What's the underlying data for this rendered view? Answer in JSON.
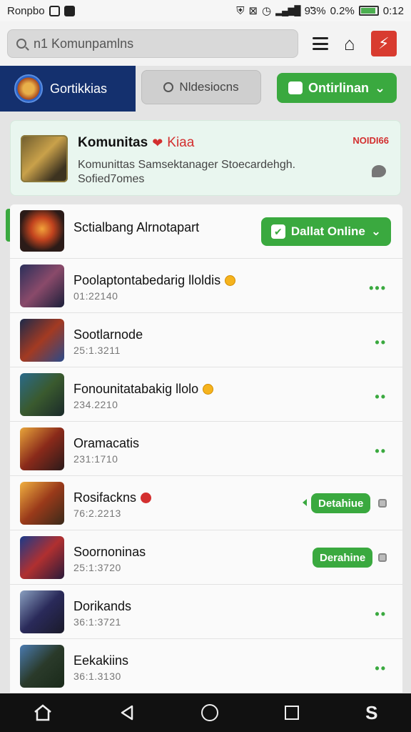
{
  "status_bar": {
    "app_name": "Ronpbo",
    "right_text": "9̃3%",
    "battery_text": "0.2%",
    "time": "0:12",
    "battery_level": 0.85
  },
  "topbar": {
    "search_text": "n1 Komunpamlns"
  },
  "tabs": {
    "profile_label": "Gortikkias",
    "search_label": "Nldesiocns",
    "online_label": "Ontirlinan"
  },
  "community": {
    "title": "Komunitas",
    "tag": "Kiaa",
    "badge": "NOIDI66",
    "description": "Komunittas Samsektanager Stoecardehgh. Sofied7omes"
  },
  "list_header": {
    "name": "Sctialbang Alrnotapart",
    "button_label": "Dallat Online"
  },
  "items": [
    {
      "name": "Poolaptontabedarig lloldis",
      "time": "01:22140",
      "badge": "coin",
      "action": "dots"
    },
    {
      "name": "Sootlarnode",
      "time": "25:1.3211",
      "badge": "",
      "action": "dots"
    },
    {
      "name": "Fonounitatabakig llolo",
      "time": "234.2210",
      "badge": "coin",
      "action": "dots"
    },
    {
      "name": "Oramacatis",
      "time": "231:1710",
      "badge": "",
      "action": "dots"
    },
    {
      "name": "Rosifackns",
      "time": "76:2.2213",
      "badge": "red",
      "action": "pill",
      "pill_label": "Detahiue"
    },
    {
      "name": "Soornoninas",
      "time": "25:1:3720",
      "badge": "",
      "action": "pill",
      "pill_label": "Derahine"
    },
    {
      "name": "Dorikands",
      "time": "36:1:3721",
      "badge": "",
      "action": "dots"
    },
    {
      "name": "Eekakiins",
      "time": "36:1.3130",
      "badge": "",
      "action": "dots"
    }
  ],
  "colors": {
    "accent_green": "#3aa93f",
    "profile_navy": "#14306e",
    "alert_red": "#d32f2f"
  },
  "icons": [
    "search-icon",
    "menu-icon",
    "home-icon",
    "bolt-icon",
    "chat-icon",
    "more-dots-icon",
    "back-icon",
    "recents-icon"
  ]
}
